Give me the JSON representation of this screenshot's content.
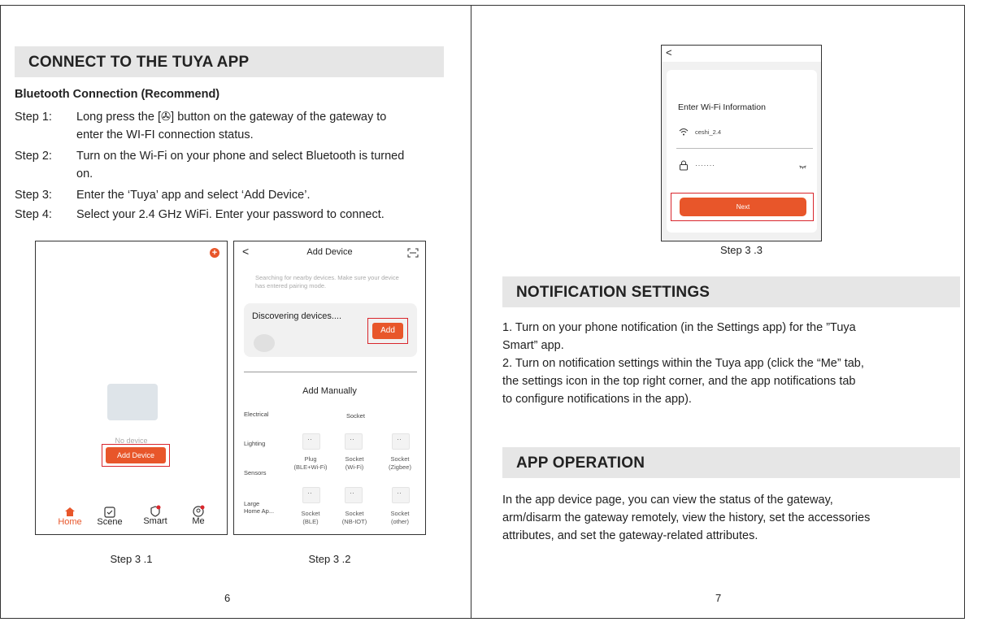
{
  "left_page": {
    "section_title": "CONNECT TO THE TUYA APP",
    "subheading": "Bluetooth Connection (Recommend)",
    "steps": [
      {
        "label": "Step 1:",
        "line1": "Long press the [✇] button on the gateway of the gateway to",
        "line2": "enter the WI-FI connection status."
      },
      {
        "label": "Step 2:",
        "line1": "Turn on the Wi-Fi on your phone and select Bluetooth is turned",
        "line2": "on."
      },
      {
        "label": "Step 3:",
        "line1": "Enter the ‘Tuya’ app and select ‘Add Device’.",
        "line2": ""
      },
      {
        "label": "Step 4:",
        "line1": "Select your 2.4 GHz WiFi. Enter your password to connect.",
        "line2": ""
      }
    ],
    "phone1": {
      "empty_text": "No device",
      "add_button": "Add Device",
      "nav": [
        "Home",
        "Scene",
        "Smart",
        "Me"
      ],
      "caption": "Step 3 .1"
    },
    "phone2": {
      "title": "Add Device",
      "hint_line1": "Searching for nearby devices. Make sure your device",
      "hint_line2": "has entered pairing mode.",
      "discovering": "Discovering devices....",
      "add_button": "Add",
      "manual_title": "Add Manually",
      "categories": [
        "Electrical",
        "Lighting",
        "Sensors",
        "Large Home Ap..."
      ],
      "socket_header": "Socket",
      "devices_row1": [
        {
          "name": "Plug",
          "sub": "(BLE+Wi-Fi)"
        },
        {
          "name": "Socket",
          "sub": "(Wi-Fi)"
        },
        {
          "name": "Socket",
          "sub": "(Zigbee)"
        }
      ],
      "devices_row2": [
        {
          "name": "Socket",
          "sub": "(BLE)"
        },
        {
          "name": "Socket",
          "sub": "(NB-IOT)"
        },
        {
          "name": "Socket",
          "sub": "(other)"
        }
      ],
      "caption": "Step 3 .2"
    },
    "page_number": "6"
  },
  "right_page": {
    "phone3": {
      "back": "<",
      "title": "Enter Wi-Fi Information",
      "ssid": "ceshi_2.4",
      "password": "·······",
      "next_button": "Next",
      "caption": "Step 3 .3"
    },
    "notification": {
      "title": "NOTIFICATION SETTINGS",
      "para1_line1": "1. Turn on your phone notification (in the Settings app) for the ”Tuya",
      "para1_line2": "Smart” app.",
      "para2_line1": "2. Turn on notification settings within the Tuya app (click the “Me” tab,",
      "para2_line2": "the settings icon in the top right corner, and the app notifications tab",
      "para2_line3": "to configure notifications in the app)."
    },
    "operation": {
      "title": "APP OPERATION",
      "line1": "In the app device page, you can view the status of the gateway,",
      "line2": "arm/disarm the gateway remotely, view the history, set the accessories",
      "line3": "attributes, and set the gateway-related attributes."
    },
    "page_number": "7"
  },
  "colors": {
    "accent": "#e8562a",
    "highlight_box": "#d9262c",
    "band": "#e6e6e6"
  }
}
